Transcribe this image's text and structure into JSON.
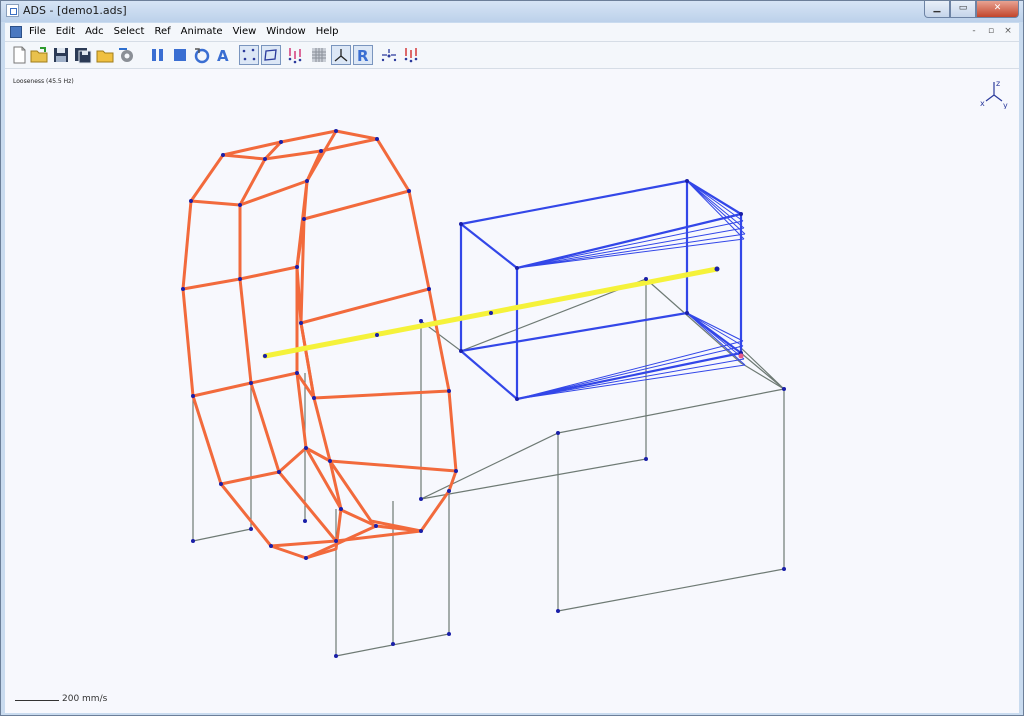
{
  "window": {
    "title": "ADS - [demo1.ads]",
    "minimize_label": "▁",
    "maximize_label": "▭",
    "close_label": "✕"
  },
  "menu": {
    "items": [
      "File",
      "Edit",
      "Adc",
      "Select",
      "Ref",
      "Animate",
      "View",
      "Window",
      "Help"
    ],
    "mdi": [
      "-",
      "▫",
      "×"
    ]
  },
  "toolbar": {
    "icons": [
      "new-file-icon",
      "open-folder-icon",
      "save-icon",
      "save-all-icon",
      "folder-icon",
      "settings-gear-icon",
      "pause-icon",
      "stop-icon",
      "loop-icon",
      "text-a-icon",
      "points-view-icon",
      "surface-view-icon",
      "deflection-arrows-icon",
      "grid-view-icon",
      "axes-view-icon",
      "reference-r-icon",
      "vector-arrows-icon",
      "color-arrows-icon"
    ],
    "a_label": "A",
    "r_label": "R"
  },
  "viewport": {
    "status_label": "Looseness (45.5 Hz)",
    "axis_x": "x",
    "axis_y": "y",
    "axis_z": "z",
    "scale_text": "200 mm/s",
    "colors": {
      "ring": "#f26a3c",
      "box": "#3347e8",
      "shaft": "#f5f23a",
      "frame": "#6e7a74",
      "node": "#1a1fa8"
    }
  }
}
